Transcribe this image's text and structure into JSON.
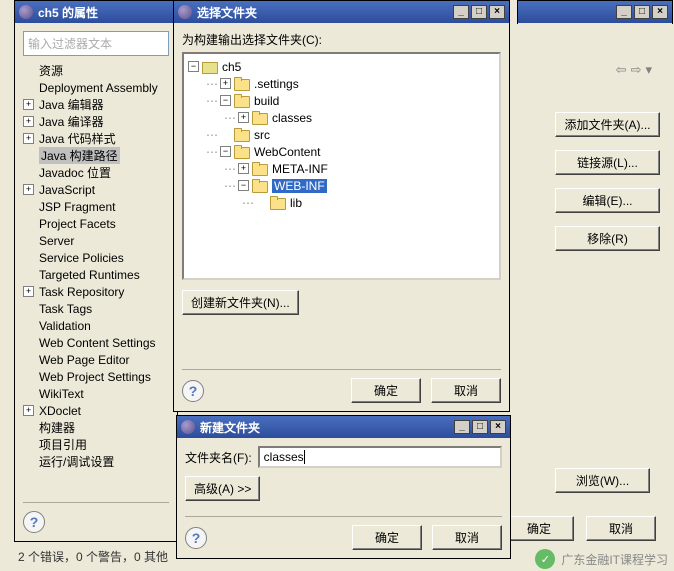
{
  "prop": {
    "title": "ch5 的属性",
    "filter_placeholder": "输入过滤器文本",
    "items": [
      "资源",
      "Deployment Assembly",
      "Java 编辑器",
      "Java 编译器",
      "Java 代码样式",
      "Java 构建路径",
      "Javadoc 位置",
      "JavaScript",
      "JSP Fragment",
      "Project Facets",
      "Server",
      "Service Policies",
      "Targeted Runtimes",
      "Task Repository",
      "Task Tags",
      "Validation",
      "Web Content Settings",
      "Web Page Editor",
      "Web Project Settings",
      "WikiText",
      "XDoclet",
      "构建器",
      "项目引用",
      "运行/调试设置"
    ],
    "selected": "Java 构建路径"
  },
  "side": {
    "add_folder": "添加文件夹(A)...",
    "link_source": "链接源(L)...",
    "edit": "编辑(E)...",
    "remove": "移除(R)"
  },
  "main": {
    "browse": "浏览(W)...",
    "ok": "确定",
    "cancel": "取消"
  },
  "sel": {
    "title": "选择文件夹",
    "instruction": "为构建输出选择文件夹(C):",
    "tree": {
      "root": "ch5",
      "n1": ".settings",
      "n2": "build",
      "n2a": "classes",
      "n3": "src",
      "n4": "WebContent",
      "n4a": "META-INF",
      "n4b": "WEB-INF",
      "n4b1": "lib"
    },
    "selected": "WEB-INF",
    "create": "创建新文件夹(N)...",
    "ok": "确定",
    "cancel": "取消"
  },
  "new": {
    "title": "新建文件夹",
    "name_label": "文件夹名(F):",
    "name_value": "classes",
    "advanced": "高级(A) >>",
    "ok": "确定",
    "cancel": "取消"
  },
  "status": "2 个错误，0 个警告，0 其他",
  "wm": "广东金融IT课程学习"
}
